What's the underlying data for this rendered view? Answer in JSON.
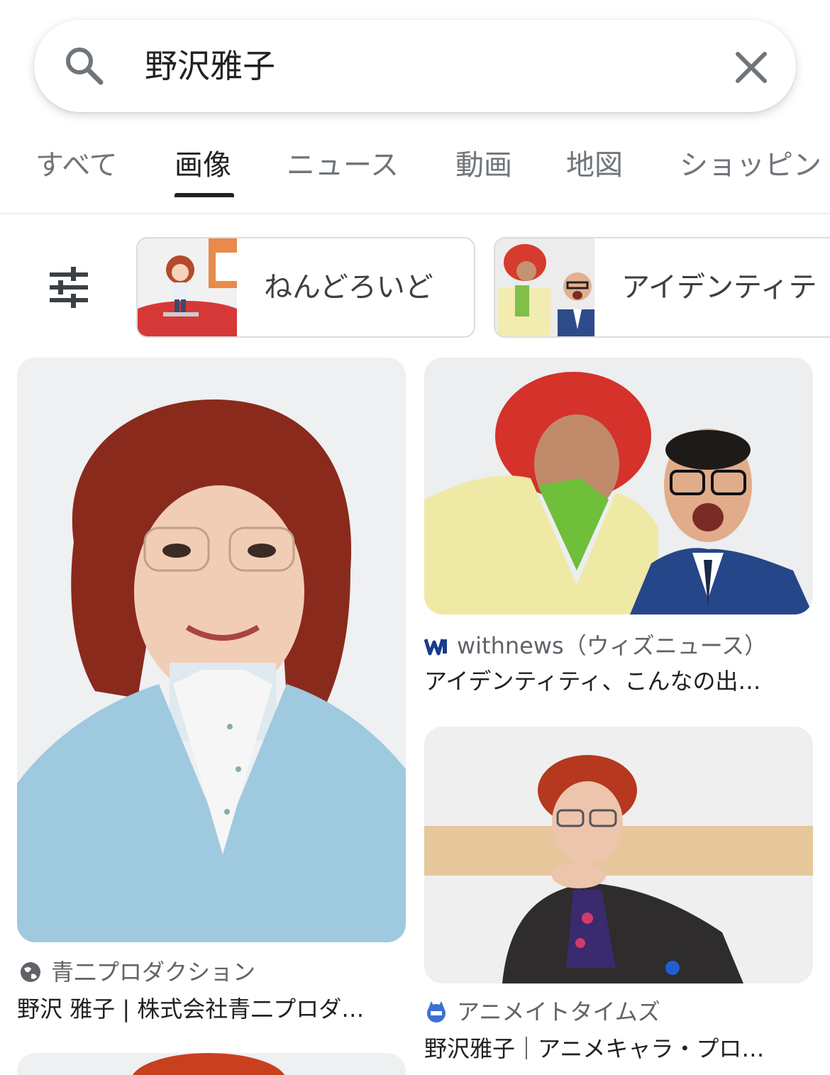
{
  "search": {
    "query": "野沢雅子"
  },
  "tabs": [
    {
      "label": "すべて",
      "active": false
    },
    {
      "label": "画像",
      "active": true
    },
    {
      "label": "ニュース",
      "active": false
    },
    {
      "label": "動画",
      "active": false
    },
    {
      "label": "地図",
      "active": false
    },
    {
      "label": "ショッピン",
      "active": false
    }
  ],
  "chips": [
    {
      "label": "ねんどろいど"
    },
    {
      "label": "アイデンティテ"
    }
  ],
  "results": [
    {
      "source": "青二プロダクション",
      "title": "野沢 雅子 | 株式会社青二プロダ…",
      "favicon": "globe-icon"
    },
    {
      "source": "withnews（ウィズニュース）",
      "title": "アイデンティティ、こんなの出…",
      "favicon": "withnews-logo"
    },
    {
      "source": "アニメイトタイムズ",
      "title": "野沢雅子｜アニメキャラ・プロ…",
      "favicon": "animate-times-logo"
    }
  ],
  "colors": {
    "accent": "#202124",
    "muted": "#70757a",
    "divider": "#ececec"
  }
}
